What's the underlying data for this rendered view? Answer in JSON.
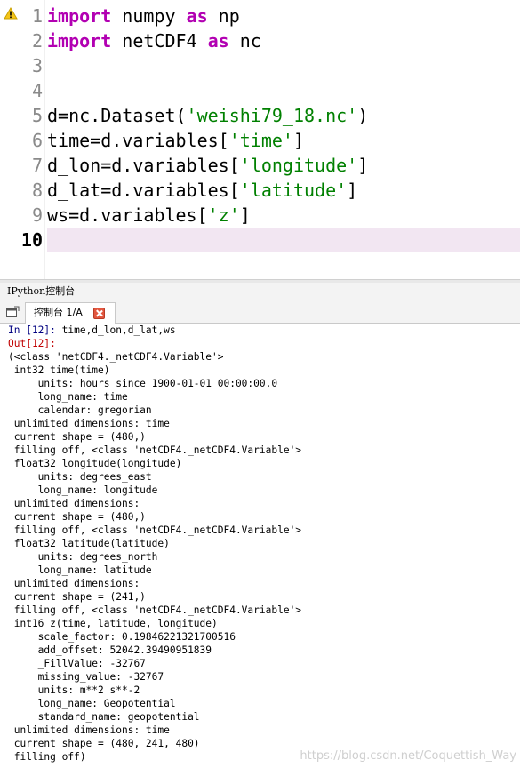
{
  "editor": {
    "lines": [
      {
        "number": "1",
        "segments": [
          {
            "text": "import",
            "style": "kw"
          },
          {
            "text": " numpy ",
            "style": "plain"
          },
          {
            "text": "as",
            "style": "kw"
          },
          {
            "text": " np",
            "style": "plain"
          }
        ]
      },
      {
        "number": "2",
        "segments": [
          {
            "text": "import",
            "style": "kw"
          },
          {
            "text": " netCDF4 ",
            "style": "plain"
          },
          {
            "text": "as",
            "style": "kw"
          },
          {
            "text": " nc",
            "style": "plain"
          }
        ]
      },
      {
        "number": "3",
        "segments": []
      },
      {
        "number": "4",
        "segments": []
      },
      {
        "number": "5",
        "segments": [
          {
            "text": "d=nc.Dataset(",
            "style": "plain"
          },
          {
            "text": "'weishi79_18.nc'",
            "style": "str"
          },
          {
            "text": ")",
            "style": "plain"
          }
        ]
      },
      {
        "number": "6",
        "segments": [
          {
            "text": "time=d.variables[",
            "style": "plain"
          },
          {
            "text": "'time'",
            "style": "str"
          },
          {
            "text": "]",
            "style": "plain"
          }
        ]
      },
      {
        "number": "7",
        "segments": [
          {
            "text": "d_lon=d.variables[",
            "style": "plain"
          },
          {
            "text": "'longitude'",
            "style": "str"
          },
          {
            "text": "]",
            "style": "plain"
          }
        ]
      },
      {
        "number": "8",
        "segments": [
          {
            "text": "d_lat=d.variables[",
            "style": "plain"
          },
          {
            "text": "'latitude'",
            "style": "str"
          },
          {
            "text": "]",
            "style": "plain"
          }
        ]
      },
      {
        "number": "9",
        "segments": [
          {
            "text": "ws=d.variables[",
            "style": "plain"
          },
          {
            "text": "'z'",
            "style": "str"
          },
          {
            "text": "]",
            "style": "plain"
          }
        ]
      },
      {
        "number": "10",
        "segments": [],
        "current": true
      }
    ],
    "warning_icon": "warning-triangle-icon"
  },
  "panel": {
    "title": "IPython控制台",
    "tab_label": "控制台 1/A",
    "tabbar_icon": "new-console-icon",
    "close_icon": "close-icon"
  },
  "console": {
    "input_prompt": "In [12]:",
    "input_text": " time,d_lon,d_lat,ws",
    "output_prompt": "Out[12]:",
    "output_lines": [
      "(<class 'netCDF4._netCDF4.Variable'>",
      " int32 time(time)",
      "     units: hours since 1900-01-01 00:00:00.0",
      "     long_name: time",
      "     calendar: gregorian",
      " unlimited dimensions: time",
      " current shape = (480,)",
      " filling off, <class 'netCDF4._netCDF4.Variable'>",
      " float32 longitude(longitude)",
      "     units: degrees_east",
      "     long_name: longitude",
      " unlimited dimensions:",
      " current shape = (480,)",
      " filling off, <class 'netCDF4._netCDF4.Variable'>",
      " float32 latitude(latitude)",
      "     units: degrees_north",
      "     long_name: latitude",
      " unlimited dimensions:",
      " current shape = (241,)",
      " filling off, <class 'netCDF4._netCDF4.Variable'>",
      " int16 z(time, latitude, longitude)",
      "     scale_factor: 0.19846221321700516",
      "     add_offset: 52042.39490951839",
      "     _FillValue: -32767",
      "     missing_value: -32767",
      "     units: m**2 s**-2",
      "     long_name: Geopotential",
      "     standard_name: geopotential",
      " unlimited dimensions: time",
      " current shape = (480, 241, 480)",
      " filling off)"
    ]
  },
  "watermark": "https://blog.csdn.net/Coquettish_Way",
  "colors": {
    "keyword": "#b200b2",
    "string": "#008000",
    "current_line": "#f2e6f2",
    "in_prompt": "#000080",
    "out_prompt": "#c00000"
  }
}
